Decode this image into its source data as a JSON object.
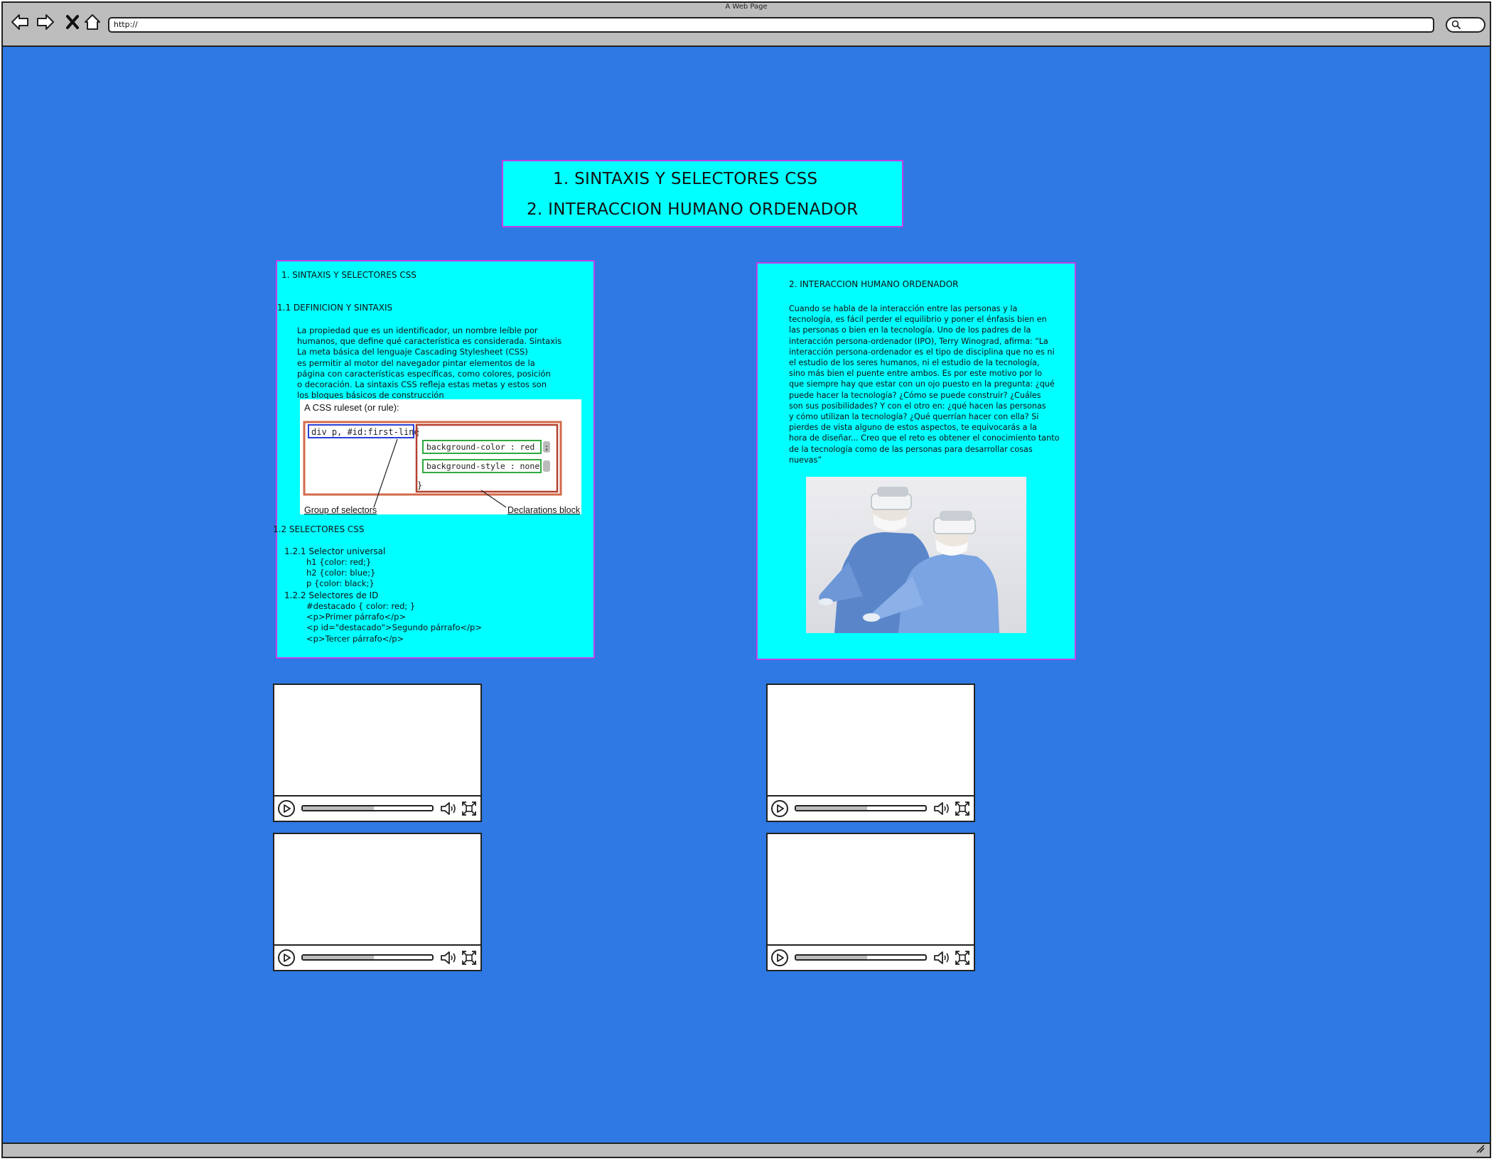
{
  "browser": {
    "title": "A Web Page",
    "url": "http://"
  },
  "title_panel": {
    "item1": "1.   SINTAXIS Y SELECTORES CSS",
    "item2": "2.  INTERACCION HUMANO ORDENADOR"
  },
  "left_panel": {
    "heading": "1.   SINTAXIS Y SELECTORES CSS",
    "sub1": "1.1   DEFINICION Y SINTAXIS",
    "definition_lines": [
      "La propiedad que es un identificador, un nombre leíble por",
      "humanos, que define qué característica es considerada. Sintaxis",
      "La meta básica del lenguaje Cascading Stylesheet (CSS)",
      "es permitir al motor del navegador pintar elementos de la",
      "página con características específicas, como colores, posición",
      "o decoración. La sintaxis CSS refleja estas metas y estos son",
      "los bloques básicos de construcción"
    ],
    "diagram": {
      "caption": "A CSS ruleset (or rule):",
      "selector": "div p, #id:first-line",
      "brace_open": "{",
      "decl1": "background-color : red",
      "semicolon": ";",
      "decl2": "background-style : none",
      "brace_close": "}",
      "label_selectors": "Group of selectors",
      "label_declarations": "Declarations block"
    },
    "sub2": "1.2  SELECTORES CSS",
    "sub3": "1.2.1  Selector universal",
    "universal_lines": [
      "h1 {color: red;}",
      "h2 {color: blue;}",
      "p {color: black;}"
    ],
    "sub4": "1.2.2  Selectores de ID",
    "id_lines": [
      "#destacado { color: red; }",
      "<p>Primer párrafo</p>",
      "<p id=\"destacado\">Segundo párrafo</p>",
      "<p>Tercer párrafo</p>"
    ]
  },
  "right_panel": {
    "heading": "2.  INTERACCION HUMANO ORDENADOR",
    "body_lines": [
      "Cuando se habla de la interacción entre las personas y la",
      "tecnología, es fácil perder el equilibrio y poner el énfasis bien en",
      "las personas o bien en la tecnología. Uno de los padres de la",
      "interacción persona-ordenador (IPO), Terry Winograd, afirma: “La",
      "interacción persona-ordenador es el tipo de disciplina que no es ni",
      "el estudio de los seres humanos, ni el estudio de la tecnología,",
      "sino más bien el puente entre ambos. Es por este motivo por lo",
      "que siempre hay que estar con un ojo puesto en la pregunta: ¿qué",
      "puede hacer la tecnología? ¿Cómo se puede construir? ¿Cuáles",
      "son sus posibilidades? Y con el otro en: ¿qué hacen las personas",
      "y cómo utilizan la tecnología? ¿Qué querrían hacer con ella? Si",
      "pierdes de vista alguno de estos aspectos, te equivocarás a la",
      "hora de diseñar... Creo que el reto es obtener el conocimiento tanto",
      "de la tecnología como de las personas para desarrollar cosas",
      "nuevas”"
    ]
  },
  "videos": [
    {
      "progress": 0.55
    },
    {
      "progress": 0.55
    },
    {
      "progress": 0.55
    },
    {
      "progress": 0.55
    }
  ],
  "colors": {
    "page_background": "#2e79e3",
    "panel_background": "#00ffff",
    "panel_border": "#c23ee8"
  }
}
